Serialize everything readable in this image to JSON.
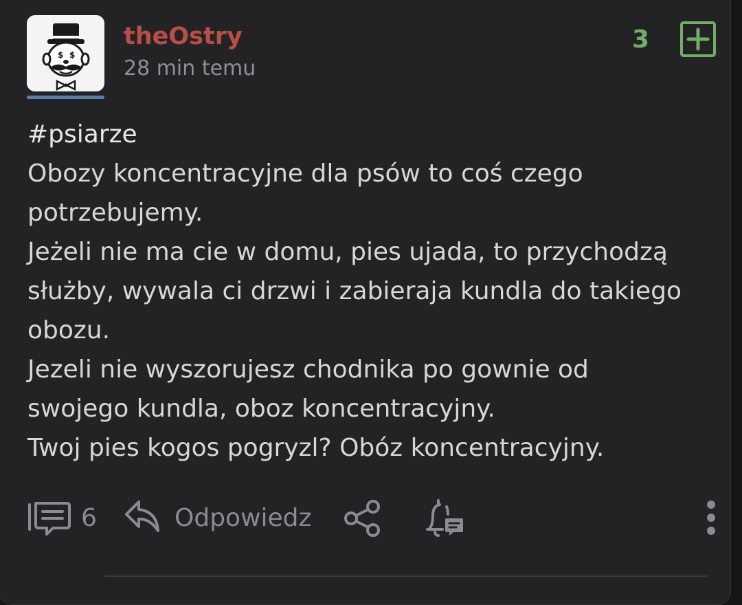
{
  "post": {
    "author": "theOstry",
    "time": "28 min temu",
    "votes": "3",
    "tag": "#psiarze",
    "lines": [
      "Obozy koncentracyjne dla psów to coś czego",
      "potrzebujemy.",
      "Jeżeli nie ma cie w domu, pies ujada, to przychodzą",
      "służby, wywala ci drzwi i zabieraja kundla do takiego",
      "obozu.",
      "Jezeli nie wyszorujesz chodnika po gownie od",
      "swojego kundla, oboz koncentracyjny.",
      "Twoj pies kogos pogryzl? Obóz koncentracyjny."
    ]
  },
  "actions": {
    "comments_count": "6",
    "reply_label": "Odpowiedz"
  },
  "icons": {
    "avatar": "monopoly-man-avatar",
    "plus": "plus-square-icon",
    "comments": "comments-icon",
    "reply": "reply-icon",
    "share": "share-icon",
    "notify": "bell-message-icon",
    "more": "more-vertical-icon"
  },
  "colors": {
    "background": "#232325",
    "author": "#b94e48",
    "votes": "#6fae64",
    "text": "#d7d7d9",
    "muted": "#8b8b90"
  }
}
